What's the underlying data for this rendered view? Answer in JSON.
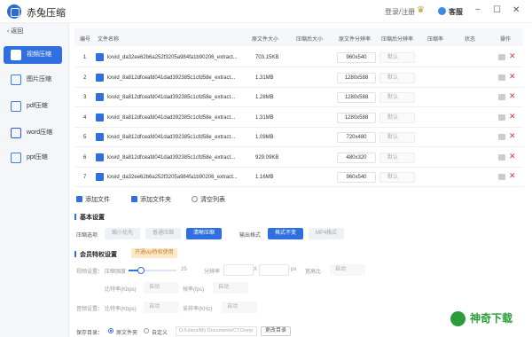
{
  "window": {
    "title": "赤兔压缩",
    "login": "登录/注册",
    "service": "客服",
    "minimize": "−",
    "maximize": "☐",
    "close": "✕"
  },
  "sidebar": {
    "back": "返回",
    "items": [
      {
        "label": "视频压缩",
        "active": true,
        "icon": "video-icon",
        "color": "#ffffff"
      },
      {
        "label": "图片压缩",
        "active": false,
        "icon": "image-icon",
        "color": "#3b7be8"
      },
      {
        "label": "pdf压缩",
        "active": false,
        "icon": "pdf-icon",
        "color": "#3b7be8"
      },
      {
        "label": "word压缩",
        "active": false,
        "icon": "word-icon",
        "color": "#2a5bd0"
      },
      {
        "label": "ppt压缩",
        "active": false,
        "icon": "ppt-icon",
        "color": "#3b7be8"
      }
    ]
  },
  "table": {
    "headers": [
      "编号",
      "文件名称",
      "原文件大小",
      "压缩后大小",
      "原文件分辨率",
      "压缩后分辨率",
      "压缩率",
      "状态",
      "操作"
    ],
    "rows": [
      {
        "num": "1",
        "name": "kxvid_da32ee62b6a252f3205a984fa1b90206_extract...",
        "size": "703.15KB",
        "res": "960x540",
        "rate": "默认"
      },
      {
        "num": "2",
        "name": "kxvid_8a812dfceafd041dad392385c1cfd58e_extract...",
        "size": "1.31MB",
        "res": "1280x588",
        "rate": "默认"
      },
      {
        "num": "3",
        "name": "kxvid_8a812dfceafd041dad392385c1cfd58e_extract...",
        "size": "1.28MB",
        "res": "1280x588",
        "rate": "默认"
      },
      {
        "num": "4",
        "name": "kxvid_8a812dfceafd041dad392385c1cfd58e_extract...",
        "size": "1.31MB",
        "res": "1280x588",
        "rate": "默认"
      },
      {
        "num": "5",
        "name": "kxvid_8a812dfceafd041dad392385c1cfd58e_extract...",
        "size": "1.09MB",
        "res": "720x480",
        "rate": "默认"
      },
      {
        "num": "6",
        "name": "kxvid_8a812dfceafd041dad392385c1cfd58e_extract...",
        "size": "929.09KB",
        "res": "480x320",
        "rate": "默认"
      },
      {
        "num": "7",
        "name": "kxvid_da32ee62b6a252f3205a984fa1b90206_extract...",
        "size": "1.16MB",
        "res": "960x540",
        "rate": "默认"
      }
    ]
  },
  "toolbar": {
    "add_file": "添加文件",
    "add_folder": "添加文件夹",
    "clear_list": "清空列表"
  },
  "basic": {
    "title": "基本设置",
    "mode_label": "压缩选项",
    "modes": [
      "缩小优先",
      "普通压缩",
      "清晰压缩"
    ],
    "format_label": "输出格式",
    "formats": [
      "格式不变",
      "MP4格式"
    ]
  },
  "advanced": {
    "title": "会员特权设置",
    "badge": "开通vip特权使用",
    "video_label": "视频设置：",
    "strength_label": "压缩强度",
    "strength_value": "25",
    "resolution_label": "分辨率",
    "res_x": "X",
    "px": "px",
    "ratio_label": "宽高比",
    "ratio_value": "自动",
    "bitrate_label": "比特率(Kbps)",
    "bitrate_value": "自动",
    "framerate_label": "帧率(fps)",
    "framerate_value": "自动",
    "audio_label": "音频设置：",
    "audio_bitrate_label": "比特率(Kbps)",
    "audio_bitrate_value": "自动",
    "sample_label": "采样率(KHz)",
    "sample_value": "自动"
  },
  "save": {
    "label": "保存目录：",
    "opt_original": "原文件夹",
    "opt_custom": "自定义",
    "path": "D:/Users/My Documents/CTComp",
    "change": "更改目录"
  },
  "watermark": {
    "text": "神奇下载"
  }
}
